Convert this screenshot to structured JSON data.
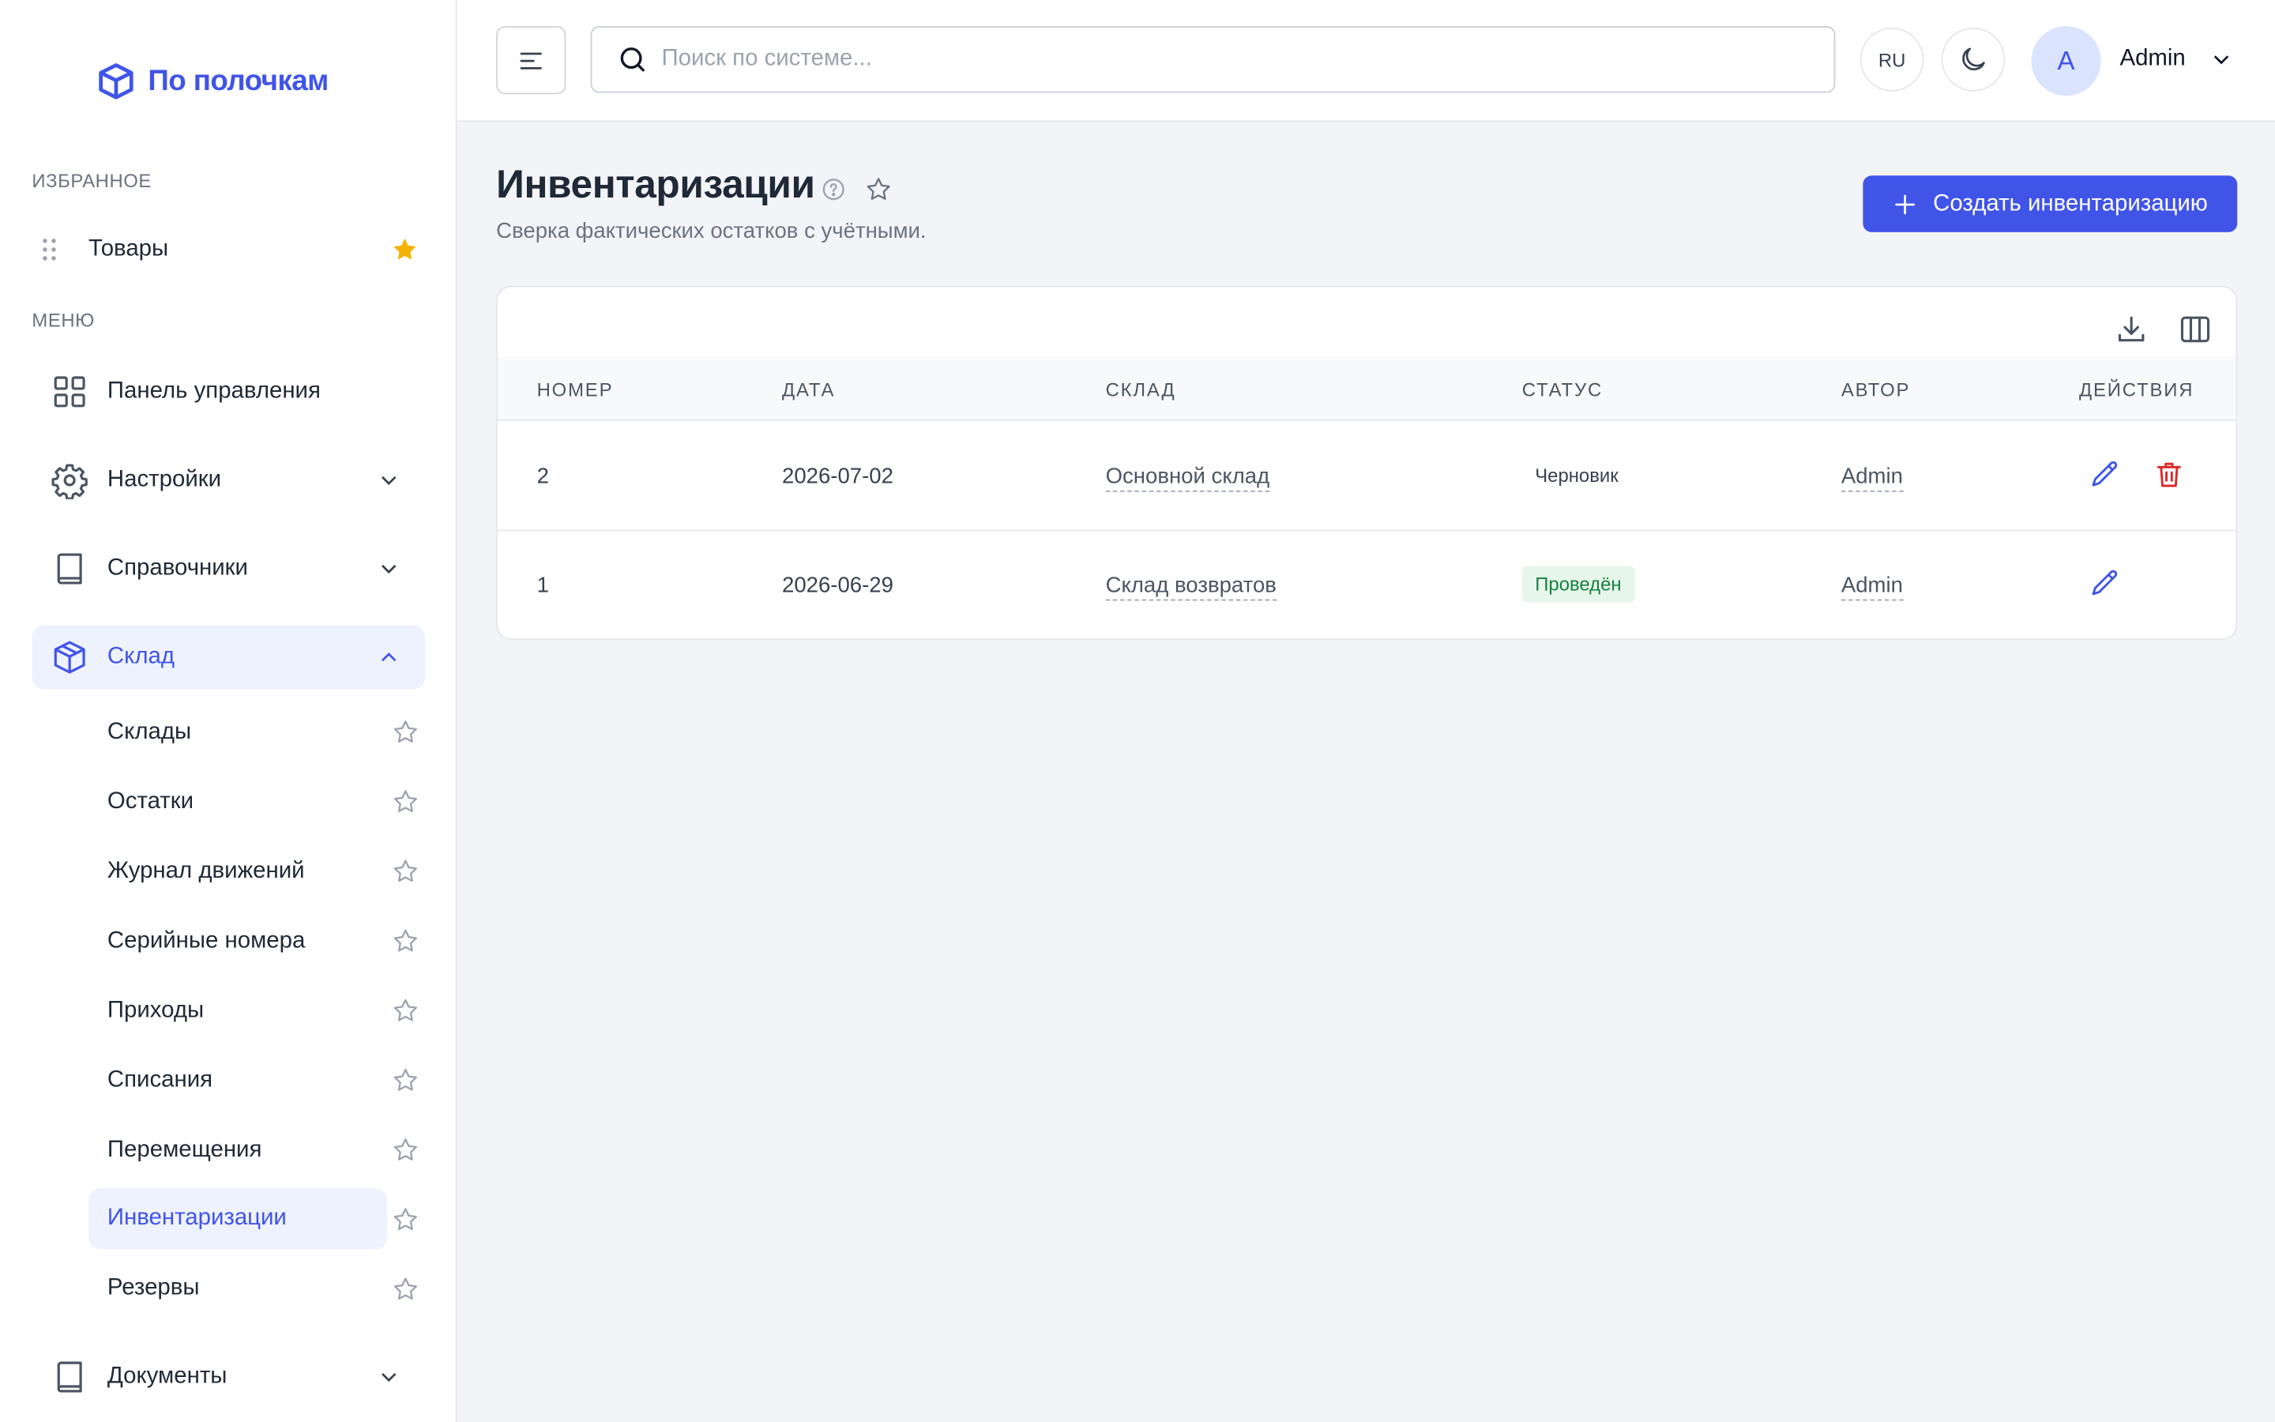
{
  "app": {
    "logo_text": "По полочкам",
    "brand_color": "#4054e8"
  },
  "sidebar": {
    "favorites_label": "ИЗБРАННОЕ",
    "favorites": [
      {
        "label": "Товары",
        "starred": true
      }
    ],
    "menu_label": "МЕНЮ",
    "items": [
      {
        "label": "Панель управления",
        "icon": "grid-icon"
      },
      {
        "label": "Настройки",
        "icon": "gear-icon",
        "expandable": true
      },
      {
        "label": "Справочники",
        "icon": "book-icon",
        "expandable": true
      },
      {
        "label": "Склад",
        "icon": "box-icon",
        "expandable": true,
        "expanded": true,
        "active": true
      },
      {
        "label": "Документы",
        "icon": "book-icon",
        "expandable": true
      }
    ],
    "warehouse_sub": [
      {
        "label": "Склады"
      },
      {
        "label": "Остатки"
      },
      {
        "label": "Журнал движений"
      },
      {
        "label": "Серийные номера"
      },
      {
        "label": "Приходы"
      },
      {
        "label": "Списания"
      },
      {
        "label": "Перемещения"
      },
      {
        "label": "Инвентаризации",
        "active": true
      },
      {
        "label": "Резервы"
      }
    ]
  },
  "header": {
    "search_placeholder": "Поиск по системе...",
    "language": "RU",
    "user_initial": "A",
    "user_name": "Admin"
  },
  "page": {
    "title": "Инвентаризации",
    "subtitle": "Сверка фактических остатков с учётными.",
    "create_button": "Создать инвентаризацию"
  },
  "table": {
    "columns": [
      "НОМЕР",
      "ДАТА",
      "СКЛАД",
      "СТАТУС",
      "АВТОР",
      "ДЕЙСТВИЯ"
    ],
    "rows": [
      {
        "number": "2",
        "date": "2026-07-02",
        "warehouse": "Основной склад",
        "status": "Черновик",
        "author": "Admin",
        "can_delete": true
      },
      {
        "number": "1",
        "date": "2026-06-29",
        "warehouse": "Склад возвратов",
        "status": "Проведён",
        "author": "Admin",
        "can_delete": false
      }
    ]
  },
  "colors": {
    "accent": "#4054e8",
    "danger": "#dc2626",
    "success": "#15803d",
    "star_active": "#f5b301"
  }
}
